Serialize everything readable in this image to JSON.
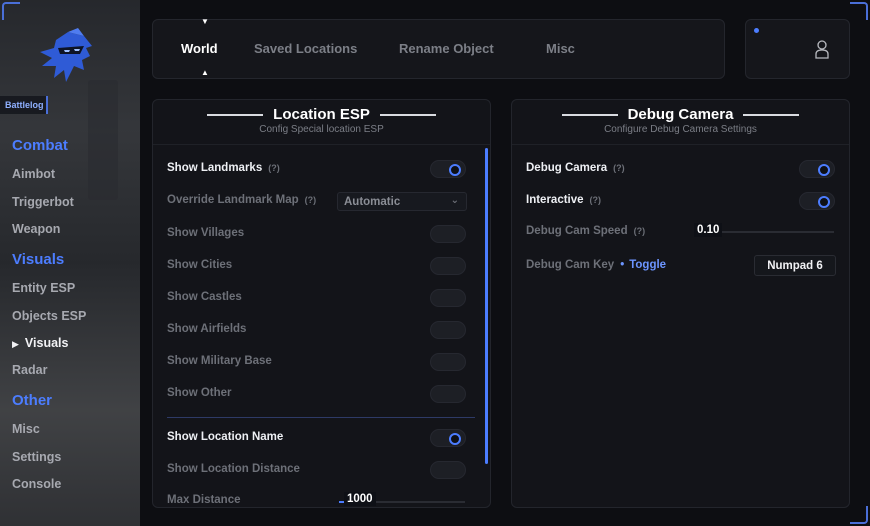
{
  "sidebar": {
    "brand_tag": "Battlelog",
    "sections": [
      {
        "title": "Combat",
        "items": [
          "Aimbot",
          "Triggerbot",
          "Weapon"
        ]
      },
      {
        "title": "Visuals",
        "items": [
          "Entity ESP",
          "Objects ESP",
          "Visuals",
          "Radar"
        ]
      },
      {
        "title": "Other",
        "items": [
          "Misc",
          "Settings",
          "Console"
        ]
      }
    ],
    "active_item": "Visuals"
  },
  "tabs": [
    "World",
    "Saved Locations",
    "Rename Object",
    "Misc"
  ],
  "active_tab": "World",
  "location_esp": {
    "title": "Location ESP",
    "subtitle": "Config Special location ESP",
    "help": "(?)",
    "rows": {
      "show_landmarks": {
        "label": "Show Landmarks",
        "enabled": true
      },
      "override_map": {
        "label": "Override Landmark Map",
        "value": "Automatic"
      },
      "show_villages": {
        "label": "Show Villages",
        "enabled": false
      },
      "show_cities": {
        "label": "Show Cities",
        "enabled": false
      },
      "show_castles": {
        "label": "Show Castles",
        "enabled": false
      },
      "show_airfields": {
        "label": "Show Airfields",
        "enabled": false
      },
      "show_military": {
        "label": "Show Military Base",
        "enabled": false
      },
      "show_other": {
        "label": "Show Other",
        "enabled": false
      },
      "show_location_name": {
        "label": "Show Location Name",
        "enabled": true
      },
      "show_location_distance": {
        "label": "Show Location Distance",
        "enabled": false
      },
      "max_distance": {
        "label": "Max Distance",
        "value": "1000"
      }
    }
  },
  "debug_camera": {
    "title": "Debug Camera",
    "subtitle": "Configure Debug Camera Settings",
    "help": "(?)",
    "rows": {
      "debug_camera": {
        "label": "Debug Camera",
        "enabled": true
      },
      "interactive": {
        "label": "Interactive",
        "enabled": true
      },
      "cam_speed": {
        "label": "Debug Cam Speed",
        "value": "0.10"
      },
      "cam_key": {
        "label": "Debug Cam Key",
        "mode": "Toggle",
        "bullet": "•",
        "key": "Numpad 6"
      }
    }
  },
  "colors": {
    "accent": "#4c7dff",
    "background": "#0d0e12",
    "panel": "#131419"
  }
}
